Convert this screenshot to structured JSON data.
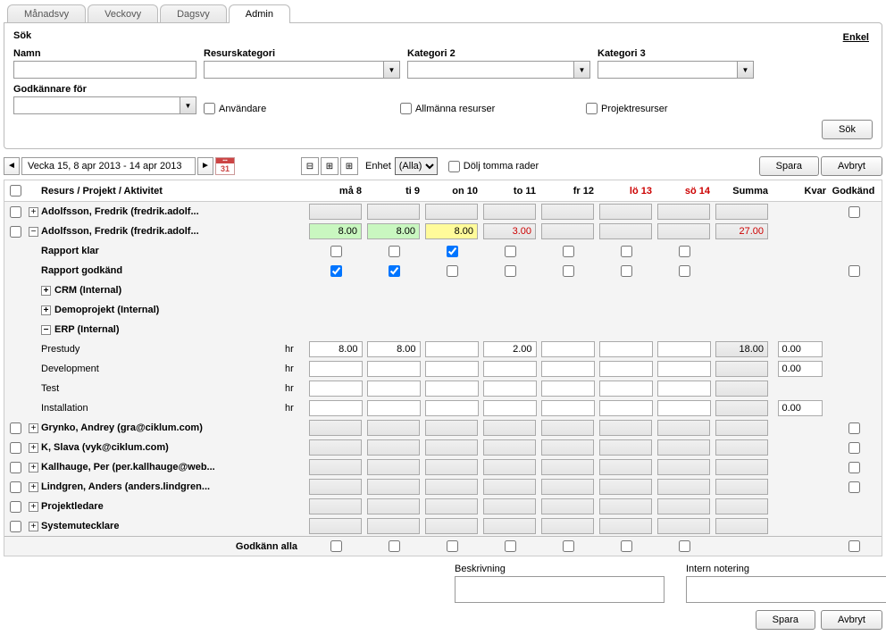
{
  "tabs": {
    "monthly": "Månadsvy",
    "weekly": "Veckovy",
    "daily": "Dagsvy",
    "admin": "Admin"
  },
  "search": {
    "title": "Sök",
    "simple_link": "Enkel",
    "labels": {
      "name": "Namn",
      "rescat": "Resurskategori",
      "cat2": "Kategori 2",
      "cat3": "Kategori 3",
      "approver": "Godkännare för"
    },
    "checkboxes": {
      "users": "Användare",
      "general": "Allmänna resurser",
      "project": "Projektresurser"
    },
    "btn": "Sök"
  },
  "toolbar": {
    "range": "Vecka 15, 8 apr 2013 - 14 apr 2013",
    "cal_num": "31",
    "unit_label": "Enhet",
    "unit_value": "(Alla)",
    "hide_empty": "Dölj tomma rader",
    "save": "Spara",
    "cancel": "Avbryt"
  },
  "grid": {
    "headers": {
      "res": "Resurs / Projekt / Aktivitet",
      "mon": "må 8",
      "tue": "ti 9",
      "wed": "on 10",
      "thu": "to 11",
      "fri": "fr 12",
      "sat": "lö 13",
      "sun": "sö 14",
      "sum": "Summa",
      "rem": "Kvar",
      "appr": "Godkänd"
    },
    "rows": {
      "r1": "Adolfsson, Fredrik (fredrik.adolf...",
      "r2": "Adolfsson, Fredrik (fredrik.adolf...",
      "r3": "Rapport klar",
      "r4": "Rapport godkänd",
      "r5": "CRM (Internal)",
      "r6": "Demoprojekt (Internal)",
      "r7": "ERP (Internal)",
      "r8": "Prestudy",
      "r9": "Development",
      "r10": "Test",
      "r11": "Installation",
      "r12": "Grynko, Andrey (gra@ciklum.com)",
      "r13": "K, Slava (vyk@ciklum.com)",
      "r14": "Kallhauge, Per (per.kallhauge@web...",
      "r15": "Lindgren, Anders (anders.lindgren...",
      "r16": "Projektledare",
      "r17": "Systemutecklare"
    },
    "vals": {
      "r2": {
        "mon": "8.00",
        "tue": "8.00",
        "wed": "8.00",
        "thu": "3.00",
        "sum": "27.00"
      },
      "r8": {
        "mon": "8.00",
        "tue": "8.00",
        "thu": "2.00",
        "sum": "18.00",
        "rem": "0.00"
      },
      "r9": {
        "rem": "0.00"
      },
      "r11": {
        "rem": "0.00"
      }
    },
    "unit_hr": "hr",
    "approve_all": "Godkänn alla"
  },
  "notes": {
    "desc": "Beskrivning",
    "internal": "Intern notering"
  },
  "footer": {
    "save": "Spara",
    "cancel": "Avbryt"
  }
}
